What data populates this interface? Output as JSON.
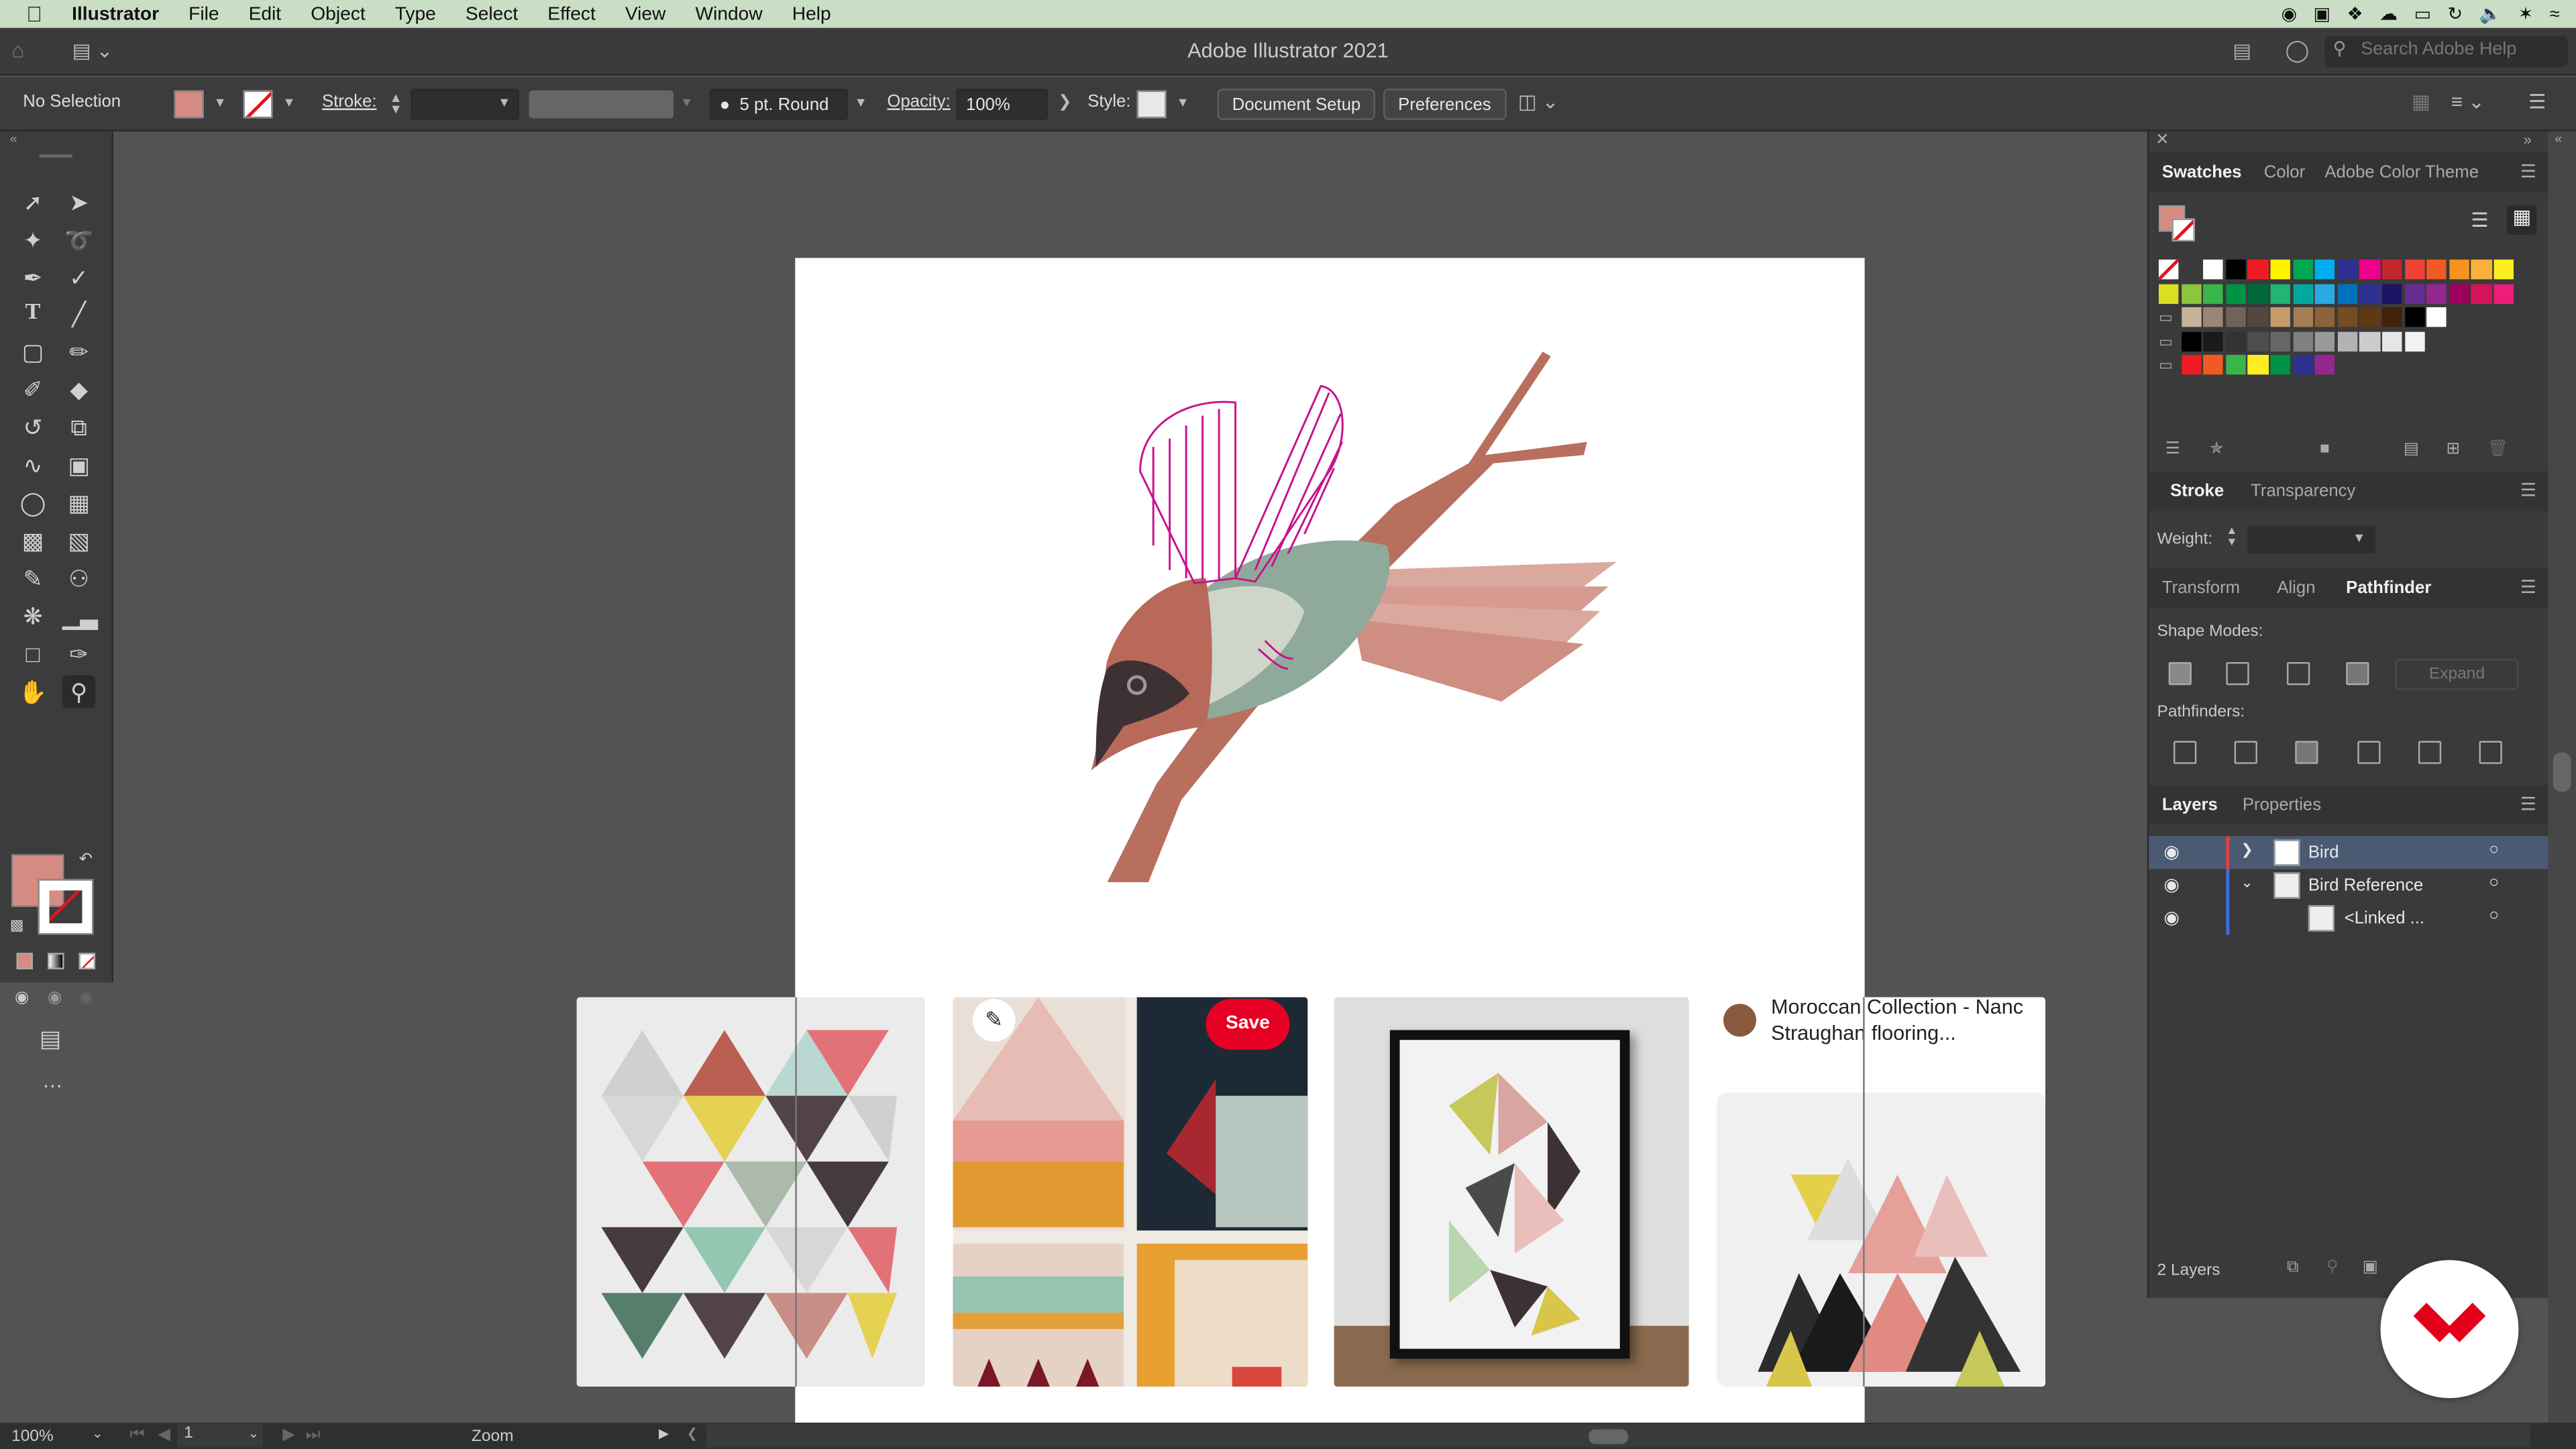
{
  "menubar": {
    "app": "Illustrator",
    "items": [
      "File",
      "Edit",
      "Object",
      "Type",
      "Select",
      "Effect",
      "View",
      "Window",
      "Help"
    ]
  },
  "titlebar": {
    "title": "Adobe Illustrator 2021",
    "search_placeholder": "Search Adobe Help"
  },
  "controlbar": {
    "selection": "No Selection",
    "stroke_label": "Stroke:",
    "brush": "5 pt. Round",
    "opacity_label": "Opacity:",
    "opacity_value": "100%",
    "style_label": "Style:",
    "document_setup": "Document Setup",
    "preferences": "Preferences"
  },
  "colors": {
    "fill": "#d68b82",
    "accent_magenta": "#c8128c",
    "branch": "#b86f5e",
    "pinterest_red": "#e60023"
  },
  "swatches_panel": {
    "tabs": [
      "Swatches",
      "Color",
      "Adobe Color Theme"
    ],
    "row1": [
      "#ffffff",
      "#000000",
      "#ed1c24",
      "#fff200",
      "#00a651",
      "#00aeef",
      "#2e3192",
      "#ec008c",
      "#c1272d",
      "#ef4136",
      "#f15a24",
      "#f7931e",
      "#fbb03b",
      "#fcee21"
    ],
    "row2": [
      "#d9e021",
      "#8cc63f",
      "#39b54a",
      "#009245",
      "#006837",
      "#22b573",
      "#00a99d",
      "#29abe2",
      "#0071bc",
      "#2e3192",
      "#1b1464",
      "#662d91",
      "#93278f",
      "#9e005d",
      "#d4145a",
      "#ed1e79"
    ],
    "row3": [
      "#c7b299",
      "#998675",
      "#736357",
      "#534741",
      "#c69c6d",
      "#a67c52",
      "#8c6239",
      "#754c24",
      "#603813",
      "#42210b",
      "#000000",
      "#ffffff"
    ],
    "row4": [
      "#000000",
      "#1a1a1a",
      "#333333",
      "#4d4d4d",
      "#666666",
      "#808080",
      "#999999",
      "#b3b3b3",
      "#cccccc",
      "#e6e6e6",
      "#f2f2f2"
    ],
    "row5": [
      "#ed1c24",
      "#f15a24",
      "#39b54a",
      "#fcee21",
      "#009245",
      "#2e3192",
      "#93278f"
    ]
  },
  "stroke_panel": {
    "tabs": [
      "Stroke",
      "Transparency"
    ],
    "weight_label": "Weight:"
  },
  "pathfinder_panel": {
    "tabs": [
      "Transform",
      "Align",
      "Pathfinder"
    ],
    "shape_modes": "Shape Modes:",
    "expand": "Expand",
    "pathfinders": "Pathfinders:"
  },
  "layers_panel": {
    "tabs": [
      "Layers",
      "Properties"
    ],
    "layers": [
      {
        "name": "Bird",
        "color": "#e2423b"
      },
      {
        "name": "Bird Reference",
        "color": "#3b6fe2"
      },
      {
        "name": "<Linked ...",
        "color": "#3b6fe2"
      }
    ],
    "count": "2 Layers"
  },
  "references": {
    "save": "Save",
    "card_title": "Moroccan Collection - Nancy Straughan flooring...",
    "card_title_line1": "Moroccan Collection - Nanc",
    "card_title_line2": "Straughan flooring..."
  },
  "statusbar": {
    "zoom": "100%",
    "artboard": "1",
    "tool": "Zoom"
  }
}
